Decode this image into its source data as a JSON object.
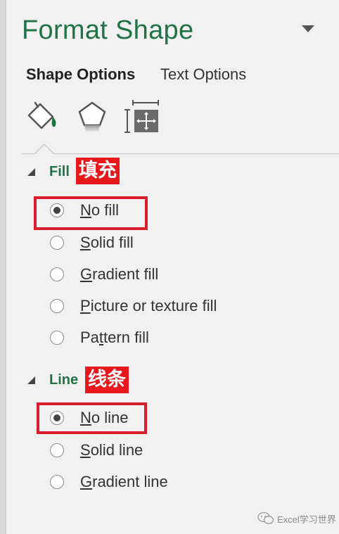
{
  "panel": {
    "title": "Format Shape",
    "tabs": [
      {
        "label": "Shape Options",
        "active": true
      },
      {
        "label": "Text Options",
        "active": false
      }
    ],
    "icons": [
      "fill-line-icon",
      "effects-pentagon-icon",
      "size-properties-icon"
    ]
  },
  "fill": {
    "title": "Fill",
    "annotation": "填充",
    "options": [
      {
        "mnemonic": "N",
        "rest": "o fill",
        "selected": true
      },
      {
        "mnemonic": "S",
        "rest": "olid fill",
        "selected": false
      },
      {
        "mnemonic": "G",
        "rest": "radient fill",
        "selected": false
      },
      {
        "mnemonic": "P",
        "rest": "icture or texture fill",
        "selected": false
      },
      {
        "pre": "Pa",
        "mnemonic": "t",
        "rest": "tern fill",
        "selected": false
      }
    ]
  },
  "line": {
    "title": "Line",
    "annotation": "线条",
    "options": [
      {
        "mnemonic": "N",
        "rest": "o line",
        "selected": true
      },
      {
        "mnemonic": "S",
        "rest": "olid line",
        "selected": false
      },
      {
        "mnemonic": "G",
        "rest": "radient line",
        "selected": false
      }
    ]
  },
  "watermark": {
    "text": "Excel学习世界"
  },
  "colors": {
    "accent_green": "#217346",
    "highlight_red": "#d81e2c",
    "label_red": "#e8191d"
  }
}
